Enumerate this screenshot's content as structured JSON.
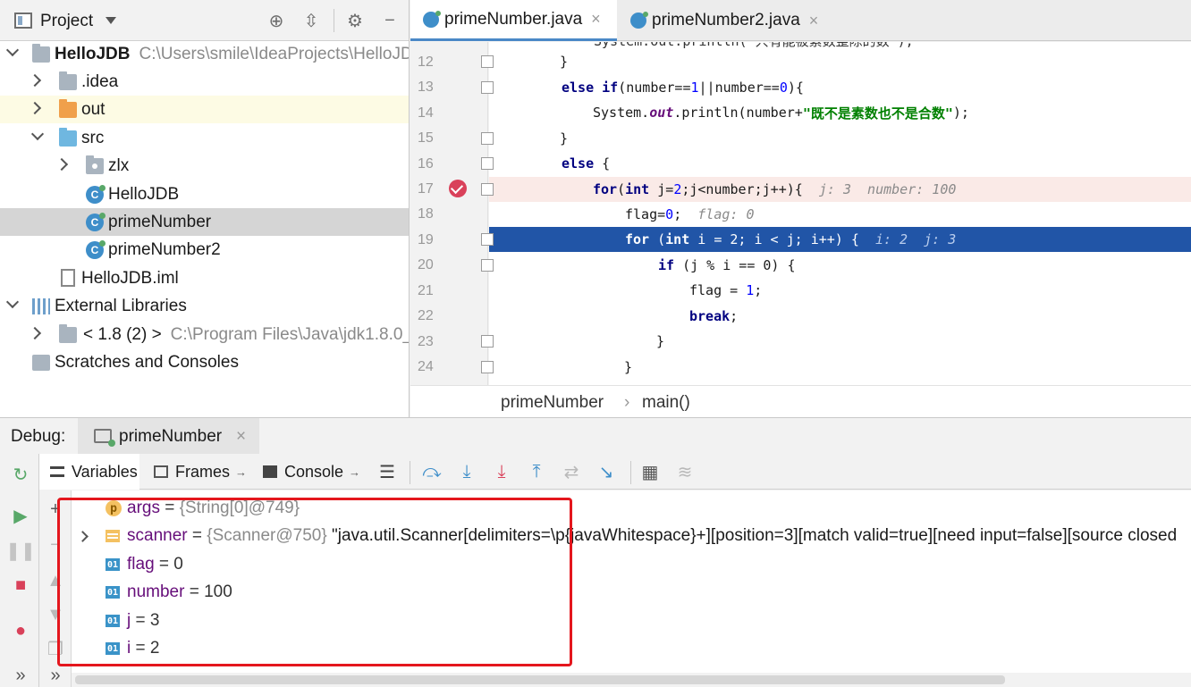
{
  "project_panel": {
    "title": "Project",
    "tree": [
      {
        "label": "HelloJDB",
        "path": "C:\\Users\\smile\\IdeaProjects\\HelloJD"
      },
      {
        "label": ".idea"
      },
      {
        "label": "out"
      },
      {
        "label": "src"
      },
      {
        "label": "zlx"
      },
      {
        "label": "HelloJDB"
      },
      {
        "label": "primeNumber"
      },
      {
        "label": "primeNumber2"
      },
      {
        "label": "HelloJDB.iml"
      },
      {
        "label": "External Libraries"
      },
      {
        "label": "< 1.8 (2) >",
        "path": "C:\\Program Files\\Java\\jdk1.8.0_"
      },
      {
        "label": "Scratches and Consoles"
      }
    ]
  },
  "editor": {
    "tabs": [
      {
        "label": "primeNumber.java",
        "close": "×"
      },
      {
        "label": "primeNumber2.java",
        "close": "×"
      }
    ],
    "line_numbers": [
      "12",
      "13",
      "14",
      "15",
      "16",
      "17",
      "18",
      "19",
      "20",
      "21",
      "22",
      "23",
      "24"
    ],
    "code": {
      "l11": "System.out.println(\"只有能被素数整除的数\");",
      "l12_brace": "}",
      "l13_else": "else",
      "l13_if": "if",
      "l13_a": "(number==",
      "l13_n1": "1",
      "l13_b": "||number==",
      "l13_n0": "0",
      "l13_c": "){",
      "l14_sys": "System.",
      "l14_out": "out",
      "l14_a": ".println(number+",
      "l14_str": "\"既不是素数也不是合数\"",
      "l14_b": ");",
      "l15_brace": "}",
      "l16_else": "else",
      "l16_b": " {",
      "l17_for": "for",
      "l17_a": "(",
      "l17_int": "int",
      "l17_b": " j=",
      "l17_n2": "2",
      "l17_c": ";j<number;j++){",
      "l17_hint": "j: 3  number: 100",
      "l18_a": "flag=",
      "l18_n0": "0",
      "l18_b": ";",
      "l18_hint": "flag: 0",
      "l19_for": "for",
      "l19_a": " (",
      "l19_int": "int",
      "l19_b": " i = 2; i < j; i++) {",
      "l19_hint": "i: 2  j: 3",
      "l20_if": "if",
      "l20_a": " (j % i == 0) {",
      "l21_a": "flag = ",
      "l21_n1": "1",
      "l21_b": ";",
      "l22_break": "break",
      "l22_b": ";",
      "l23_brace": "}",
      "l24_brace": "}"
    },
    "breadcrumb": [
      "primeNumber",
      "main()"
    ]
  },
  "debug": {
    "label": "Debug:",
    "session_tab": "primeNumber",
    "session_close": "×",
    "subtabs": [
      "Variables",
      "Frames",
      "Console"
    ],
    "variables": [
      {
        "icon": "p",
        "name": "args",
        "eq": " = ",
        "obj": "{String[0]@749}",
        "value": ""
      },
      {
        "icon": "obj",
        "name": "scanner",
        "eq": " = ",
        "obj": "{Scanner@750}",
        "value": " \"java.util.Scanner[delimiters=\\p{javaWhitespace}+][position=3][match valid=true][need input=false][source closed"
      },
      {
        "icon": "01",
        "name": "flag",
        "eq": " = ",
        "value": "0"
      },
      {
        "icon": "01",
        "name": "number",
        "eq": " = ",
        "value": "100"
      },
      {
        "icon": "01",
        "name": "j",
        "eq": " = ",
        "value": "3"
      },
      {
        "icon": "01",
        "name": "i",
        "eq": " = ",
        "value": "2"
      }
    ],
    "more_glyph": "»"
  },
  "colors": {
    "accent": "#2155a7",
    "breakpoint": "#d9415a",
    "annotation_box": "#e4161d"
  }
}
